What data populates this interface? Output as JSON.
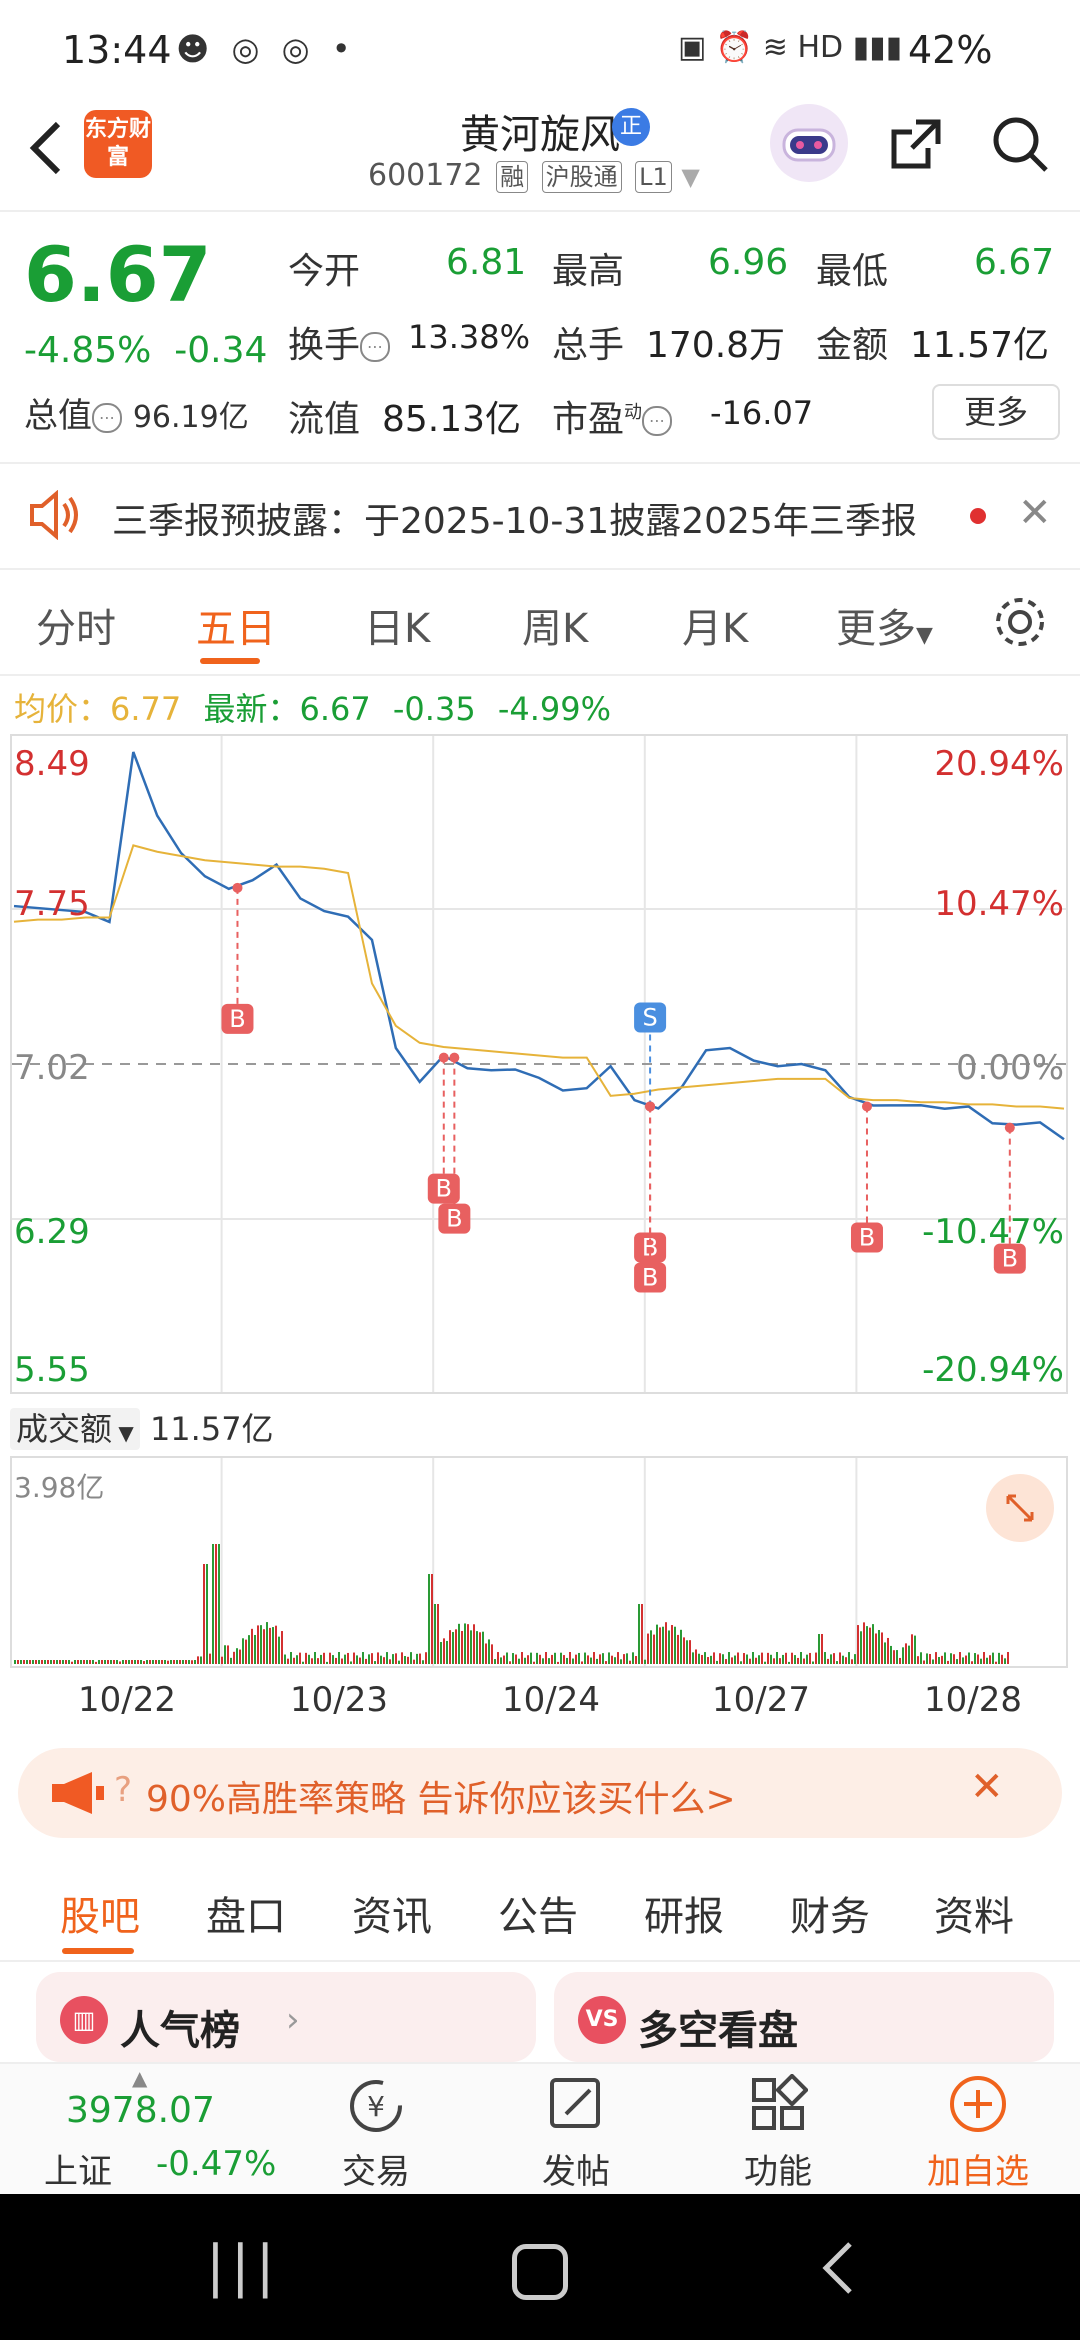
{
  "status_bar": {
    "time": "13:44",
    "battery": "42%"
  },
  "header": {
    "logo_text": "东方财富",
    "stock_name": "黄河旋风",
    "badge": "正",
    "code": "600172",
    "tags": [
      "融",
      "沪股通",
      "L1"
    ]
  },
  "quote": {
    "price": "6.67",
    "change_pct": "-4.85%",
    "change": "-0.34",
    "total_value_label": "总值",
    "total_value": "96.19亿",
    "fields": [
      {
        "label": "今开",
        "value": "6.81"
      },
      {
        "label": "最高",
        "value": "6.96"
      },
      {
        "label": "最低",
        "value": "6.67"
      },
      {
        "label": "换手",
        "value": "13.38%"
      },
      {
        "label": "总手",
        "value": "170.8万"
      },
      {
        "label": "金额",
        "value": "11.57亿"
      },
      {
        "label": "流值",
        "value": "85.13亿"
      },
      {
        "label": "市盈",
        "superscript": "动",
        "value": "-16.07"
      }
    ],
    "more_label": "更多"
  },
  "notice": {
    "text": "三季报预披露：于2025-10-31披露2025年三季报"
  },
  "chart_tabs": [
    "分时",
    "五日",
    "日K",
    "周K",
    "月K",
    "更多"
  ],
  "active_chart_tab": "五日",
  "avg_line": {
    "avg_label": "均价：",
    "avg_value": "6.77",
    "latest_label": "最新：",
    "latest_value": "6.67",
    "change": "-0.35",
    "pct": "-4.99%"
  },
  "chart_data": {
    "type": "line",
    "x_dates": [
      "10/22",
      "10/23",
      "10/24",
      "10/27",
      "10/28"
    ],
    "y_ticks_left": [
      "8.49",
      "7.75",
      "7.02",
      "6.29",
      "5.55"
    ],
    "y_ticks_right": [
      "20.94%",
      "10.47%",
      "0.00%",
      "-10.47%",
      "-20.94%"
    ],
    "ylim": [
      5.55,
      8.49
    ],
    "prev_close": 7.02,
    "series": [
      {
        "values": [
          7.75,
          7.75,
          7.75,
          7.75,
          7.68,
          8.49,
          8.2,
          8.0,
          7.9,
          7.85,
          7.9,
          7.95,
          7.8,
          7.75,
          7.7,
          7.6,
          7.1,
          6.95,
          7.05,
          7.0,
          7.0,
          6.98,
          6.95,
          6.9,
          6.92,
          7.0,
          6.85,
          6.82,
          6.9,
          7.08,
          7.1,
          7.05,
          7.0,
          7.02,
          7.0,
          6.85,
          6.82,
          6.83,
          6.84,
          6.8,
          6.82,
          6.75,
          6.72,
          6.74,
          6.67
        ]
      },
      {
        "values": [
          7.69,
          7.7,
          7.7,
          7.71,
          7.71,
          8.05,
          8.02,
          8.0,
          7.98,
          7.97,
          7.96,
          7.95,
          7.95,
          7.94,
          7.92,
          7.4,
          7.2,
          7.12,
          7.1,
          7.09,
          7.08,
          7.07,
          7.06,
          7.05,
          7.05,
          6.87,
          6.88,
          6.9,
          6.91,
          6.92,
          6.93,
          6.94,
          6.95,
          6.95,
          6.95,
          6.86,
          6.85,
          6.85,
          6.84,
          6.84,
          6.83,
          6.83,
          6.82,
          6.82,
          6.81
        ]
      }
    ],
    "markers": [
      "B",
      "B",
      "B",
      "S",
      "B",
      "B",
      "B",
      "B"
    ]
  },
  "volume": {
    "label": "成交额",
    "value": "11.57亿",
    "max_label": "3.98亿"
  },
  "banner": {
    "text": "90%高胜率策略 告诉你应该买什么>"
  },
  "section_tabs": [
    "股吧",
    "盘口",
    "资讯",
    "公告",
    "研报",
    "财务",
    "资料"
  ],
  "active_section_tab": "股吧",
  "cards": [
    {
      "title": "人气榜"
    },
    {
      "title": "多空看盘"
    }
  ],
  "bottom_bar": {
    "index_value": "3978.07",
    "index_name": "上证",
    "index_change": "-0.47%",
    "items": [
      "交易",
      "发帖",
      "功能",
      "加自选"
    ]
  },
  "colors": {
    "up": "#d33030",
    "down": "#1a9e35",
    "accent": "#f0631c",
    "price_line": "#2f6db5",
    "avg_line": "#e6b33a"
  }
}
